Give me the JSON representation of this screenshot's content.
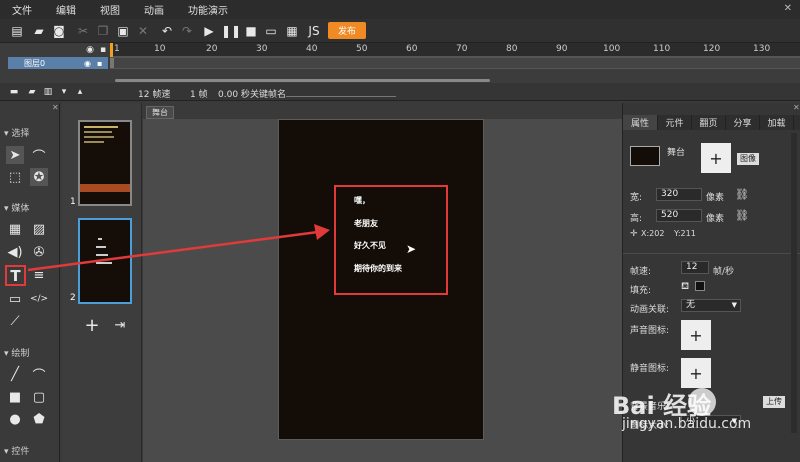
{
  "menu": [
    "文件",
    "编辑",
    "视图",
    "动画",
    "功能演示"
  ],
  "toolbar": {
    "publish_label": "发布"
  },
  "timeline": {
    "ruler_labels": [
      "1",
      "10",
      "20",
      "30",
      "40",
      "50",
      "60",
      "70",
      "80",
      "90",
      "100",
      "110",
      "120",
      "130"
    ],
    "layer_name": "图层0"
  },
  "status": {
    "fps": "12 帧速",
    "frame": "1 帧",
    "time": "0.00 秒",
    "keyframe_name": "关键帧名"
  },
  "toolbox": {
    "section_select": "选择",
    "section_media": "媒体",
    "section_draw": "绘制",
    "section_controls": "控件"
  },
  "pages": {
    "page1_num": "1",
    "page2_num": "2"
  },
  "stage": {
    "tab_label": "舞台",
    "lines": [
      "嘿，",
      "老朋友",
      "好久不见",
      "期待你的到来"
    ]
  },
  "props": {
    "tabs": [
      "属性",
      "元件",
      "翻页",
      "分享",
      "加载"
    ],
    "stage_label": "舞台",
    "image_button": "图像",
    "width_label": "宽:",
    "width_value": "320",
    "height_label": "高:",
    "height_value": "520",
    "unit": "像素",
    "x_coord": "X:202",
    "y_coord": "Y:211",
    "framerate_label": "帧速:",
    "framerate_value": "12",
    "framerate_unit": "帧/秒",
    "fill_label": "填充:",
    "anim_link_label": "动画关联:",
    "anim_link_value": "无",
    "sound_icon_label": "声音图标:",
    "mute_icon_label": "静音图标:",
    "bgm_label": "背景音乐:",
    "upload_label": "上传",
    "icon_size_label": "图标大小:",
    "icon_size_value": "小"
  },
  "watermark": {
    "brand": "Bai 经验",
    "url": "jingyan.baidu.com"
  },
  "colors": {
    "accent": "#f08a24",
    "highlight": "#e03a3a",
    "stage_bg": "#140d07",
    "selected": "#4a9fd8"
  }
}
